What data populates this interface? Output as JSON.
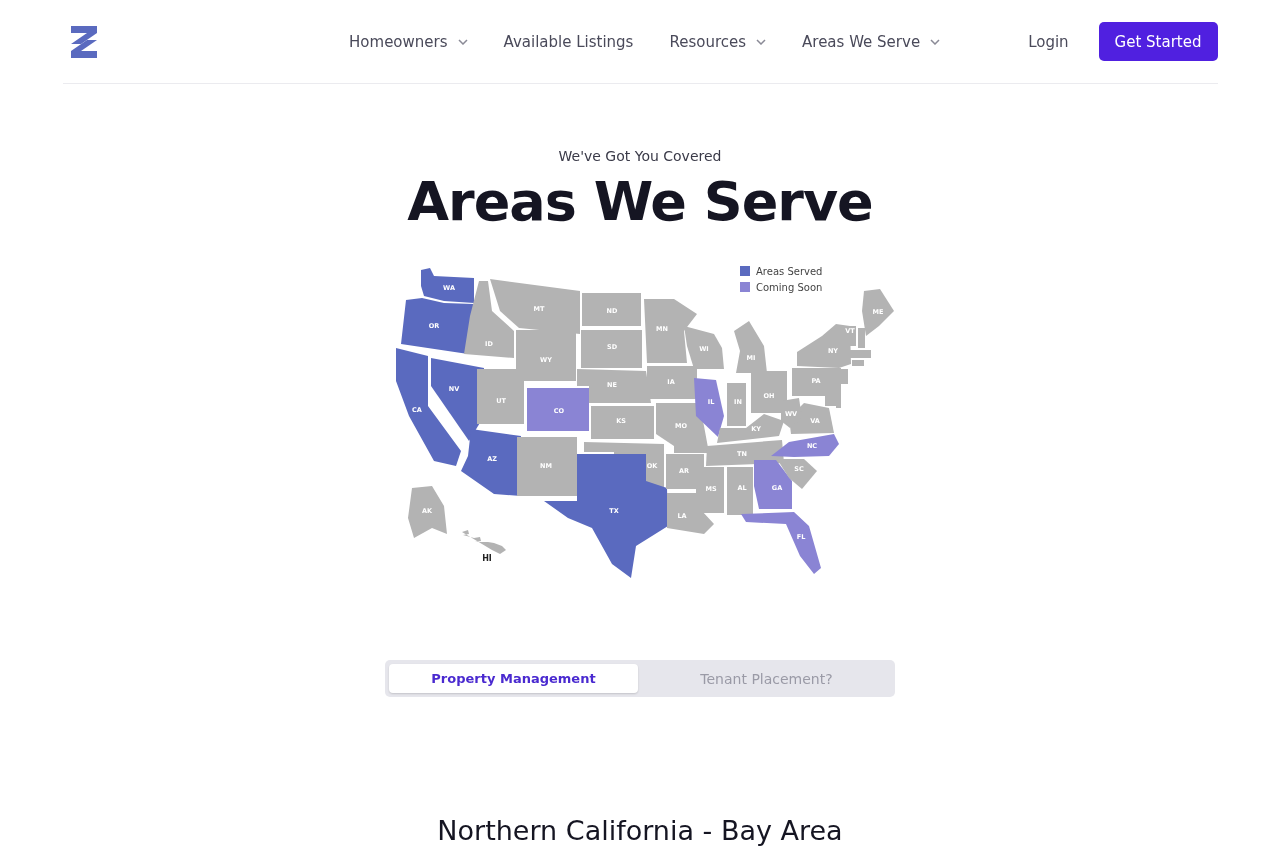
{
  "nav": {
    "links": [
      {
        "label": "Homeowners",
        "dropdown": true
      },
      {
        "label": "Available Listings",
        "dropdown": false
      },
      {
        "label": "Resources",
        "dropdown": true
      },
      {
        "label": "Areas We Serve",
        "dropdown": true
      }
    ],
    "login": "Login",
    "cta": "Get Started"
  },
  "hero": {
    "eyebrow": "We've Got You Covered",
    "title": "Areas We Serve"
  },
  "map": {
    "legend": [
      {
        "label": "Areas Served",
        "color": "#5a6abf"
      },
      {
        "label": "Coming Soon",
        "color": "#8a84d4"
      }
    ],
    "states": [
      {
        "code": "WA",
        "color": "#5a6abf"
      },
      {
        "code": "OR",
        "color": "#5a6abf"
      },
      {
        "code": "CA",
        "color": "#5a6abf"
      },
      {
        "code": "NV",
        "color": "#5a6abf"
      },
      {
        "code": "ID",
        "color": "#b3b3b3"
      },
      {
        "code": "MT",
        "color": "#b3b3b3"
      },
      {
        "code": "WY",
        "color": "#b3b3b3"
      },
      {
        "code": "UT",
        "color": "#b3b3b3"
      },
      {
        "code": "CO",
        "color": "#8a84d4"
      },
      {
        "code": "AZ",
        "color": "#5a6abf"
      },
      {
        "code": "NM",
        "color": "#b3b3b3"
      },
      {
        "code": "ND",
        "color": "#b3b3b3"
      },
      {
        "code": "SD",
        "color": "#b3b3b3"
      },
      {
        "code": "NE",
        "color": "#b3b3b3"
      },
      {
        "code": "KS",
        "color": "#b3b3b3"
      },
      {
        "code": "OK",
        "color": "#b3b3b3"
      },
      {
        "code": "TX",
        "color": "#5a6abf"
      },
      {
        "code": "MN",
        "color": "#b3b3b3"
      },
      {
        "code": "IA",
        "color": "#b3b3b3"
      },
      {
        "code": "MO",
        "color": "#b3b3b3"
      },
      {
        "code": "AR",
        "color": "#b3b3b3"
      },
      {
        "code": "LA",
        "color": "#b3b3b3"
      },
      {
        "code": "WI",
        "color": "#b3b3b3"
      },
      {
        "code": "MI",
        "color": "#b3b3b3"
      },
      {
        "code": "IL",
        "color": "#8a84d4"
      },
      {
        "code": "IN",
        "color": "#b3b3b3"
      },
      {
        "code": "OH",
        "color": "#b3b3b3"
      },
      {
        "code": "KY",
        "color": "#b3b3b3"
      },
      {
        "code": "TN",
        "color": "#b3b3b3"
      },
      {
        "code": "MS",
        "color": "#b3b3b3"
      },
      {
        "code": "AL",
        "color": "#b3b3b3"
      },
      {
        "code": "GA",
        "color": "#8a84d4"
      },
      {
        "code": "FL",
        "color": "#8a84d4"
      },
      {
        "code": "SC",
        "color": "#b3b3b3"
      },
      {
        "code": "NC",
        "color": "#8a84d4"
      },
      {
        "code": "VA",
        "color": "#b3b3b3"
      },
      {
        "code": "WV",
        "color": "#b3b3b3"
      },
      {
        "code": "PA",
        "color": "#b3b3b3"
      },
      {
        "code": "NY",
        "color": "#b3b3b3"
      },
      {
        "code": "ME",
        "color": "#b3b3b3"
      },
      {
        "code": "VT",
        "color": "#b3b3b3"
      },
      {
        "code": "AK",
        "color": "#b3b3b3"
      },
      {
        "code": "HI",
        "color": "#b3b3b3"
      },
      {
        "color": "#b3b3b3"
      },
      {
        "color": "#b3b3b3"
      },
      {
        "color": "#b3b3b3"
      },
      {
        "color": "#b3b3b3"
      },
      {
        "color": "#b3b3b3"
      },
      {
        "color": "#b3b3b3"
      }
    ]
  },
  "toggle": [
    {
      "label": "Property Management",
      "selected": true
    },
    {
      "label": "Tenant Placement?",
      "selected": false
    }
  ],
  "section_title": "Northern California - Bay Area"
}
